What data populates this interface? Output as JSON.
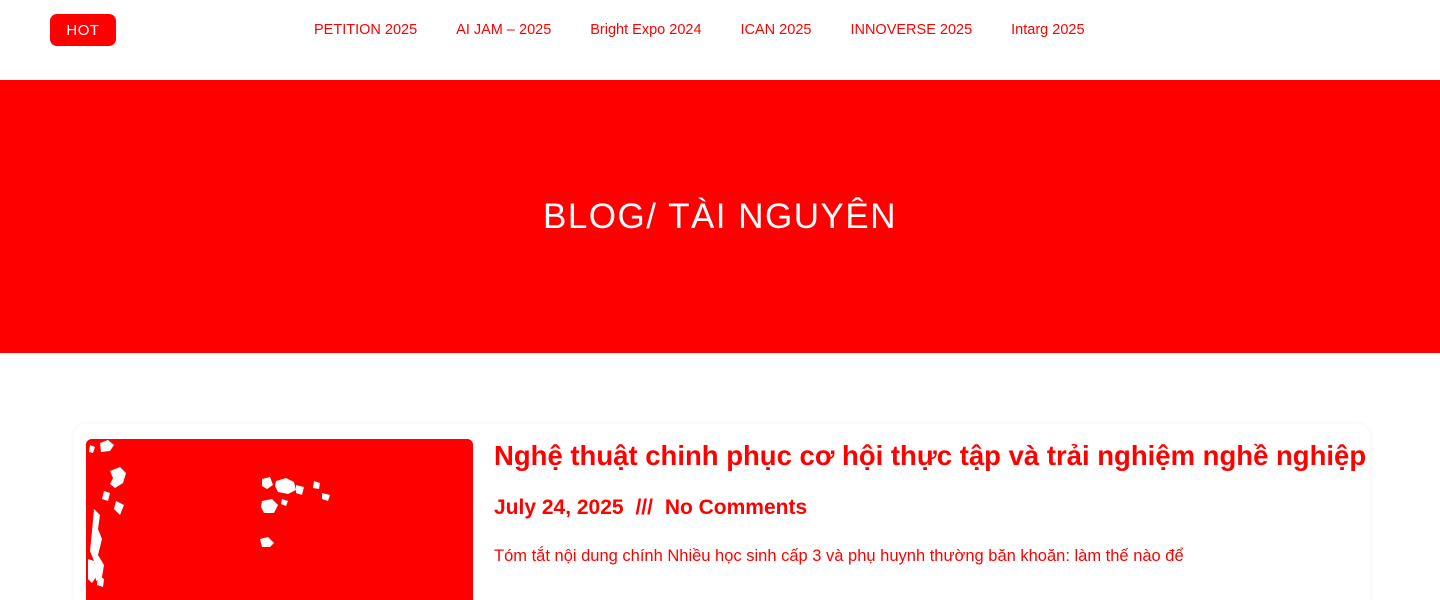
{
  "header": {
    "badge": "HOT",
    "nav": [
      "PETITION 2025",
      "AI JAM – 2025",
      "Bright Expo 2024",
      "ICAN 2025",
      "INNOVERSE 2025",
      "Intarg 2025"
    ]
  },
  "hero": {
    "title": "BLOG/ TÀI NGUYÊN"
  },
  "post": {
    "title": "Nghệ thuật chinh phục cơ hội thực tập và trải nghiệm nghề nghiệp",
    "date": "July 24, 2025",
    "separator": "///",
    "comments": "No Comments",
    "excerpt": "Tóm tắt nội dung chính Nhiều học sinh cấp 3 và phụ huynh thường băn khoăn: làm thế nào để"
  },
  "colors": {
    "accent": "#ff0000",
    "background": "#ffffff",
    "text_on_accent": "#ffffff"
  }
}
